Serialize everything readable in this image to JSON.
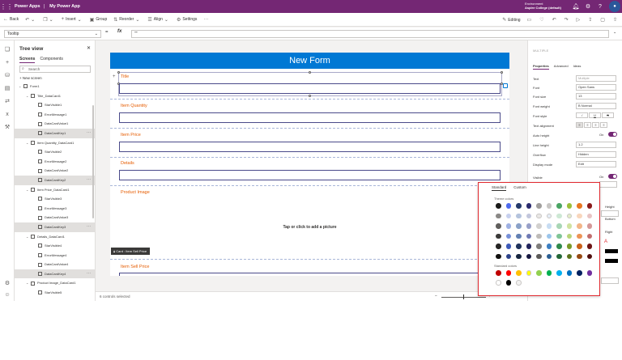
{
  "titlebar": {
    "app_name": "Power Apps",
    "separator": "|",
    "app_title": "My Power App",
    "environment_label": "Environment",
    "environment_name": "Aspire College (default)"
  },
  "commandbar": {
    "back": "Back",
    "insert": "Insert",
    "group": "Group",
    "reorder": "Reorder",
    "align": "Align",
    "settings": "Settings",
    "editing": "Editing"
  },
  "formulabar": {
    "property": "Tooltip",
    "equals": "=",
    "fx": "fx",
    "formula": "\"\""
  },
  "tree": {
    "title": "Tree view",
    "tabs": [
      "Screens",
      "Components"
    ],
    "search_placeholder": "Search",
    "new_screen": "+ New screen",
    "items": [
      {
        "label": "Form1",
        "depth": 1,
        "type": "form",
        "chevron": "⌄",
        "selected": false
      },
      {
        "label": "Title_DataCard1",
        "depth": 2,
        "type": "card",
        "chevron": "⌄",
        "selected": false
      },
      {
        "label": "StarVisible1",
        "depth": 3,
        "type": "control",
        "chevron": "",
        "selected": false
      },
      {
        "label": "ErrorMessage1",
        "depth": 3,
        "type": "control",
        "chevron": "",
        "selected": false
      },
      {
        "label": "DataCardValue1",
        "depth": 3,
        "type": "control",
        "chevron": "",
        "selected": false
      },
      {
        "label": "DataCardKey1",
        "depth": 3,
        "type": "control",
        "chevron": "",
        "selected": true
      },
      {
        "label": "Item Quantity_DataCard1",
        "depth": 2,
        "type": "card",
        "chevron": "⌄",
        "selected": false
      },
      {
        "label": "StarVisible2",
        "depth": 3,
        "type": "control",
        "chevron": "",
        "selected": false
      },
      {
        "label": "ErrorMessage2",
        "depth": 3,
        "type": "control",
        "chevron": "",
        "selected": false
      },
      {
        "label": "DataCardValue2",
        "depth": 3,
        "type": "control",
        "chevron": "",
        "selected": false
      },
      {
        "label": "DataCardKey2",
        "depth": 3,
        "type": "control",
        "chevron": "",
        "selected": true
      },
      {
        "label": "Item Price_DataCard1",
        "depth": 2,
        "type": "card",
        "chevron": "⌄",
        "selected": false
      },
      {
        "label": "StarVisible3",
        "depth": 3,
        "type": "control",
        "chevron": "",
        "selected": false
      },
      {
        "label": "ErrorMessage3",
        "depth": 3,
        "type": "control",
        "chevron": "",
        "selected": false
      },
      {
        "label": "DataCardValue3",
        "depth": 3,
        "type": "control",
        "chevron": "",
        "selected": false
      },
      {
        "label": "DataCardKey3",
        "depth": 3,
        "type": "control",
        "chevron": "",
        "selected": true
      },
      {
        "label": "Details_DataCard1",
        "depth": 2,
        "type": "card",
        "chevron": "⌄",
        "selected": false
      },
      {
        "label": "StarVisible4",
        "depth": 3,
        "type": "control",
        "chevron": "",
        "selected": false
      },
      {
        "label": "ErrorMessage4",
        "depth": 3,
        "type": "control",
        "chevron": "",
        "selected": false
      },
      {
        "label": "DataCardValue4",
        "depth": 3,
        "type": "control",
        "chevron": "",
        "selected": false
      },
      {
        "label": "DataCardKey4",
        "depth": 3,
        "type": "control",
        "chevron": "",
        "selected": true
      },
      {
        "label": "Product Image_DataCard1",
        "depth": 2,
        "type": "card",
        "chevron": "⌄",
        "selected": false
      },
      {
        "label": "StarVisible5",
        "depth": 3,
        "type": "control",
        "chevron": "",
        "selected": false
      }
    ]
  },
  "form": {
    "header": "New Form",
    "fields": [
      "Title",
      "Item Quantity",
      "Item Price",
      "Details",
      "Product Image",
      "Item Sell Price"
    ],
    "picture_prompt": "Tap or click to add a picture",
    "tooltip": "Card : Item Sell Price"
  },
  "status": {
    "selection": "6 controls selected"
  },
  "properties": {
    "control_name": "MULTIPLE",
    "tabs": [
      "Properties",
      "Advanced",
      "Ideas"
    ],
    "text_label": "Text",
    "text_value": "Multiple",
    "font_label": "Font",
    "font_value": "Open Sans",
    "font_size_label": "Font size",
    "font_size_value": "13",
    "font_weight_label": "Font weight",
    "font_weight_value": "B  Normal",
    "font_style_label": "Font style",
    "font_style_values": [
      "/",
      "U",
      "S"
    ],
    "text_alignment_label": "Text alignment",
    "auto_height_label": "Auto height",
    "auto_height_value": "On",
    "line_height_label": "Line height",
    "line_height_value": "1.2",
    "overflow_label": "Overflow",
    "overflow_value": "Hidden",
    "display_mode_label": "Display mode",
    "display_mode_value": "Edit",
    "visible_label": "Visible",
    "visible_value": "On",
    "right_labels": [
      "Height",
      "Bottom",
      "Right"
    ]
  },
  "picker": {
    "tabs": [
      "Standard",
      "Custom"
    ],
    "theme_label": "Theme colors",
    "standard_label": "Standard colors",
    "theme_rows": [
      [
        "#1b1a19",
        "#4f6bed",
        "#243a6b",
        "#2b2b6e",
        "#a19f9d",
        "#c8c6c4",
        "#4aa564",
        "#9bbf3b",
        "#e87722",
        "#8b1a1a"
      ],
      [
        "#8a8886",
        "#c7d0ee",
        "#b4c3dd",
        "#c2c6dc",
        "#e8e6e4",
        "#e6eef8",
        "#cde8d4",
        "#e3edc8",
        "#f8d6bc",
        "#e8c3c3"
      ],
      [
        "#605e5c",
        "#9fb1e3",
        "#8aa1c8",
        "#98a0c8",
        "#d2d0ce",
        "#c7dcf2",
        "#a8d6b5",
        "#d0e2a0",
        "#f2b588",
        "#d59898"
      ],
      [
        "#3b3a39",
        "#7790d8",
        "#6280b3",
        "#6f7ab4",
        "#bebbb8",
        "#9cc5eb",
        "#7fc596",
        "#b9d47a",
        "#ec9456",
        "#c26d6d"
      ],
      [
        "#252423",
        "#3d5ab8",
        "#1e325c",
        "#22245c",
        "#7f7d7b",
        "#3d7fc1",
        "#2f8a4c",
        "#7a9a2a",
        "#c9611a",
        "#6e1414"
      ],
      [
        "#11100f",
        "#2c4289",
        "#16253f",
        "#171840",
        "#5b5a58",
        "#2c5f92",
        "#236838",
        "#5c731f",
        "#964913",
        "#520f0f"
      ]
    ],
    "standard_row": [
      "#c00000",
      "#ff0000",
      "#ffc000",
      "#ffff00",
      "#92d050",
      "#00b050",
      "#00b0f0",
      "#0070c0",
      "#002060",
      "#7030a0"
    ],
    "extra_row": [
      "#ffffff",
      "#000000",
      "#f3f2f1"
    ]
  }
}
